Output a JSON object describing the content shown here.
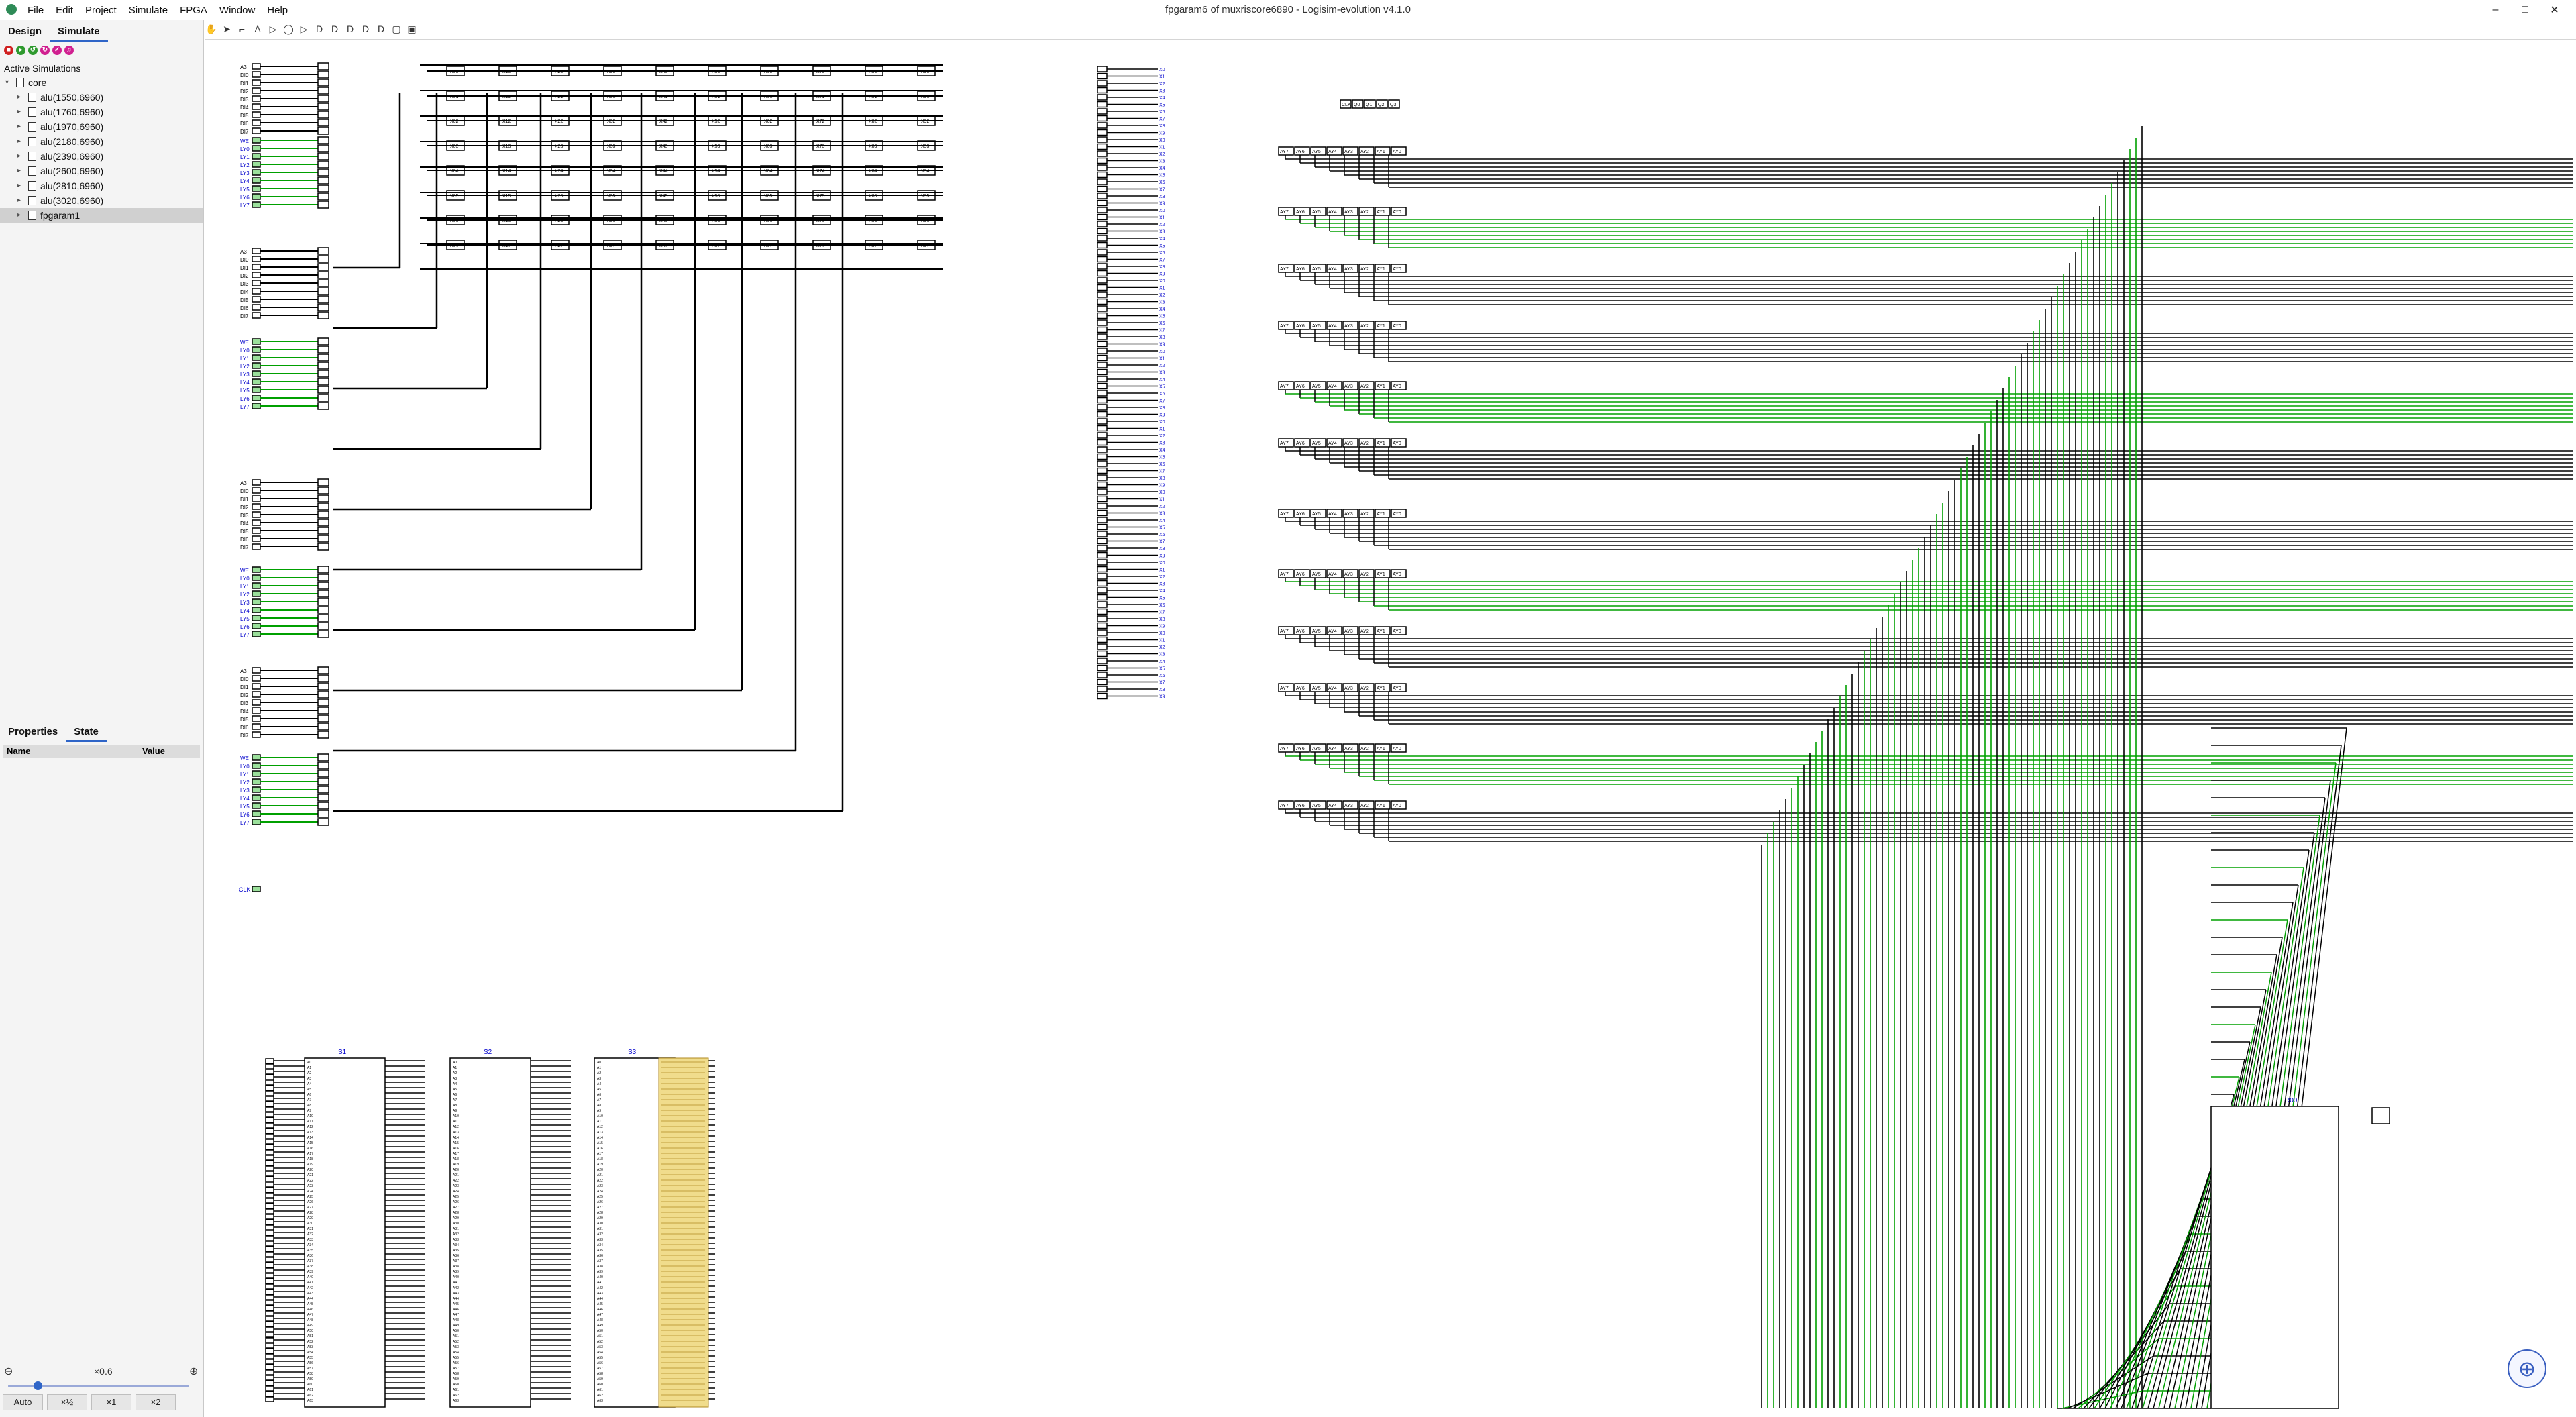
{
  "window": {
    "title": "fpgaram6 of muxriscore6890 - Logisim-evolution v4.1.0",
    "controls": [
      "–",
      "□",
      "✕"
    ]
  },
  "menu": {
    "file": "File",
    "edit": "Edit",
    "project": "Project",
    "simulate": "Simulate",
    "fpga": "FPGA",
    "window": "Window",
    "help": "Help"
  },
  "sidebar": {
    "tabs": {
      "design": "Design",
      "simulate": "Simulate"
    },
    "active_simulations_label": "Active Simulations",
    "tree": [
      {
        "label": "core",
        "level": 0
      },
      {
        "label": "alu(1550,6960)",
        "level": 1
      },
      {
        "label": "alu(1760,6960)",
        "level": 1
      },
      {
        "label": "alu(1970,6960)",
        "level": 1
      },
      {
        "label": "alu(2180,6960)",
        "level": 1
      },
      {
        "label": "alu(2390,6960)",
        "level": 1
      },
      {
        "label": "alu(2600,6960)",
        "level": 1
      },
      {
        "label": "alu(2810,6960)",
        "level": 1
      },
      {
        "label": "alu(3020,6960)",
        "level": 1
      },
      {
        "label": "fpgaram1",
        "level": 1,
        "selected": true
      }
    ],
    "props_tabs": {
      "properties": "Properties",
      "state": "State"
    },
    "props_columns": {
      "name": "Name",
      "value": "Value"
    }
  },
  "zoom": {
    "value": "×0.6",
    "buttons": [
      "Auto",
      "×½",
      "×1",
      "×2"
    ]
  },
  "circuit_labels": {
    "ram_blocks": [
      "S1",
      "S2",
      "S3"
    ],
    "ram_right": "R00",
    "clk_label": "CLK",
    "input_group_a": [
      "A3",
      "DI0",
      "DI1",
      "DI2",
      "DI3",
      "DI4",
      "DI5",
      "DI6",
      "DI7"
    ],
    "input_group_l": [
      "WE",
      "LY0",
      "LY1",
      "LY2",
      "LY3",
      "LY4",
      "LY5",
      "LY6",
      "LY7"
    ],
    "header_row_labels": [
      "AY7",
      "AY6",
      "AY5",
      "AY4",
      "AY3",
      "AY2",
      "AY1",
      "AY0"
    ],
    "register_header": [
      "CLK",
      "Q0",
      "Q1",
      "Q2",
      "Q3"
    ]
  },
  "colors": {
    "wire_black": "#000000",
    "wire_green": "#00a000",
    "wire_dark_green": "#006400",
    "label_blue": "#0000cc",
    "highlight_yellow": "#f0dc8c",
    "accent": "#2f65c8"
  }
}
